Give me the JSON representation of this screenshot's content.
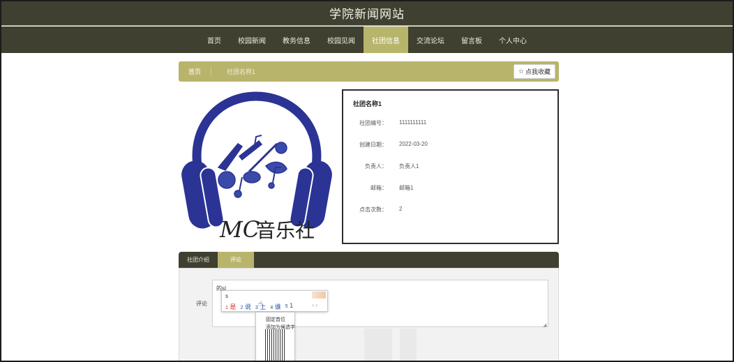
{
  "site": {
    "title": "学院新闻网站"
  },
  "nav": {
    "items": [
      {
        "label": "首页",
        "active": false
      },
      {
        "label": "校园新闻",
        "active": false
      },
      {
        "label": "教务信息",
        "active": false
      },
      {
        "label": "校园见闻",
        "active": false
      },
      {
        "label": "社团信息",
        "active": true
      },
      {
        "label": "交流论坛",
        "active": false
      },
      {
        "label": "留言板",
        "active": false
      },
      {
        "label": "个人中心",
        "active": false
      }
    ]
  },
  "breadcrumb": {
    "home": "首页",
    "current": "社团名称1"
  },
  "favorite": {
    "icon": "star-outline-icon",
    "label": "点我收藏"
  },
  "logo": {
    "text_mc": "MC",
    "text_name": "音乐社",
    "color": "#2b3494"
  },
  "club": {
    "name": "社团名称1",
    "fields": [
      {
        "label": "社团编号：",
        "value": "1111111111"
      },
      {
        "label": "创建日期：",
        "value": "2022-03-20"
      },
      {
        "label": "负责人：",
        "value": "负责人1"
      },
      {
        "label": "邮箱：",
        "value": "邮箱1"
      },
      {
        "label": "点击次数：",
        "value": "2"
      }
    ]
  },
  "tabs": [
    {
      "label": "社团介绍",
      "active": false
    },
    {
      "label": "评论",
      "active": true
    }
  ],
  "comment": {
    "label": "评论",
    "value": "的s|"
  },
  "ime": {
    "input": "s",
    "candidates": [
      {
        "num": "1",
        "text": "是"
      },
      {
        "num": "2",
        "text": "说"
      },
      {
        "num": "3",
        "text": "上"
      },
      {
        "num": "4",
        "text": "谁"
      },
      {
        "num": "5",
        "text": "1"
      }
    ],
    "nav": "‹ ›"
  },
  "context_menu": {
    "items": [
      "固定首位",
      "添加为候选字"
    ]
  },
  "colors": {
    "nav_bg": "#3f4030",
    "accent": "#b8b46c"
  }
}
